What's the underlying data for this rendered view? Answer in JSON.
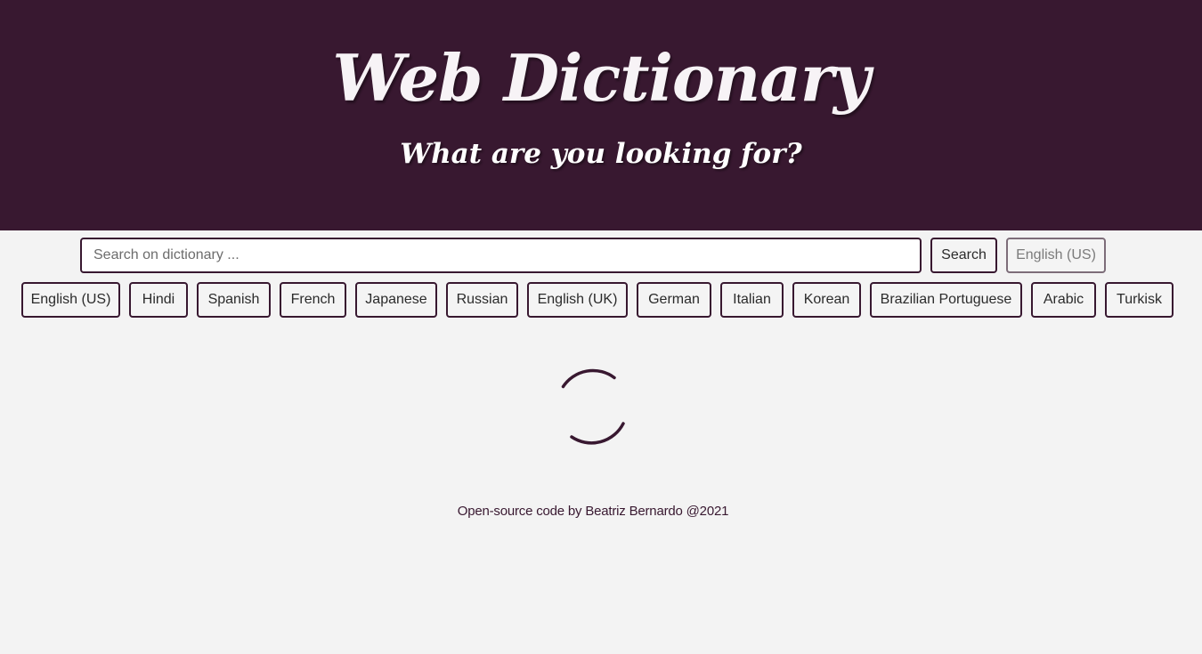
{
  "header": {
    "title": "Web Dictionary",
    "subtitle": "What are you looking for?",
    "background_color": "#381830",
    "text_color": "#f4f4f4"
  },
  "search": {
    "placeholder": "Search on dictionary ...",
    "value": "",
    "button_label": "Search",
    "current_language": "English (US)"
  },
  "languages": [
    "English (US)",
    "Hindi",
    "Spanish",
    "French",
    "Japanese",
    "Russian",
    "English (UK)",
    "German",
    "Italian",
    "Korean",
    "Brazilian Portuguese",
    "Arabic",
    "Turkisk"
  ],
  "loading": {
    "icon": "loading-spinner-icon",
    "color": "#381830"
  },
  "footer": {
    "credit": "Open-source code by Beatriz Bernardo @2021"
  }
}
